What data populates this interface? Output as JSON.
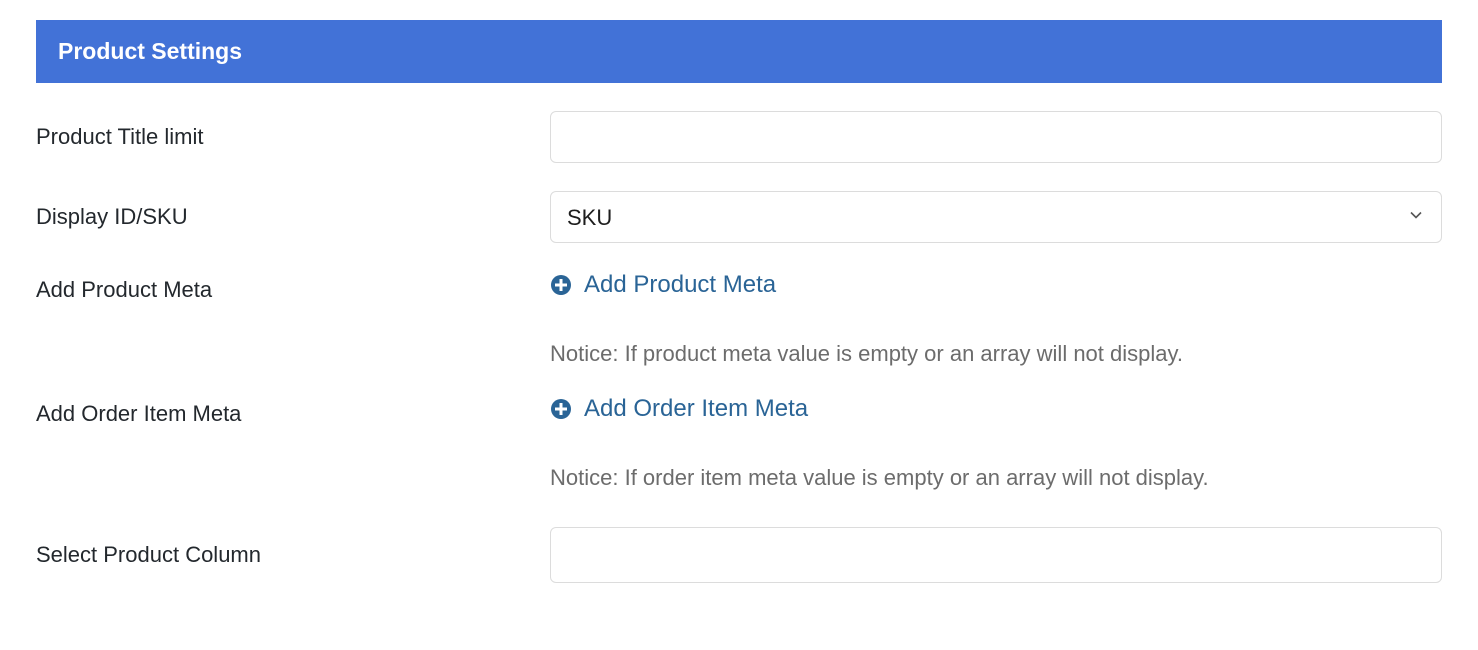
{
  "header": {
    "title": "Product Settings"
  },
  "fields": {
    "productTitleLimit": {
      "label": "Product Title limit",
      "value": ""
    },
    "displayIdSku": {
      "label": "Display ID/SKU",
      "value": "SKU"
    },
    "addProductMeta": {
      "label": "Add Product Meta",
      "linkText": "Add Product Meta",
      "notice": "Notice: If product meta value is empty or an array will not display."
    },
    "addOrderItemMeta": {
      "label": "Add Order Item Meta",
      "linkText": "Add Order Item Meta",
      "notice": "Notice: If order item meta value is empty or an array will not display."
    },
    "selectProductColumn": {
      "label": "Select Product Column",
      "value": ""
    }
  }
}
